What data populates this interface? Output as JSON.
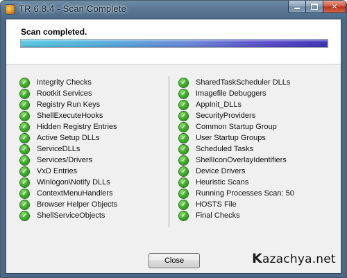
{
  "window": {
    "app_name": "TR 6.8.4",
    "title_sep": " - ",
    "title_state": "Scan Complete"
  },
  "status": {
    "heading": "Scan completed.",
    "progress_percent": 100
  },
  "checks_left": [
    "Integrity Checks",
    "Rootkit Services",
    "Registry Run Keys",
    "ShellExecuteHooks",
    "Hidden Registry Entries",
    "Active Setup DLLs",
    "ServiceDLLs",
    "Services/Drivers",
    "VxD Entries",
    "Winlogon\\Notify DLLs",
    "ContextMenuHandlers",
    "Browser Helper Objects",
    "ShellServiceObjects"
  ],
  "checks_right": [
    "SharedTaskScheduler DLLs",
    "Imagefile Debuggers",
    "AppInit_DLLs",
    "SecurityProviders",
    "Common Startup Group",
    "User Startup Groups",
    "Scheduled Tasks",
    "ShellIconOverlayIdentifiers",
    "Device Drivers",
    "Heuristic Scans",
    "Running Processes Scan: 50",
    "HOSTS File",
    "Final Checks"
  ],
  "check_glyph": "✓",
  "buttons": {
    "close_label": "Close"
  },
  "watermark": {
    "k": "K",
    "rest": "azachya.net"
  },
  "icons": {
    "app": "app-icon",
    "check": "check-circle-icon"
  },
  "colors": {
    "check_green": "#3fae2a",
    "progress_start": "#5ac8e0",
    "progress_end": "#3f36b8",
    "titlebar": "#5a7894"
  }
}
